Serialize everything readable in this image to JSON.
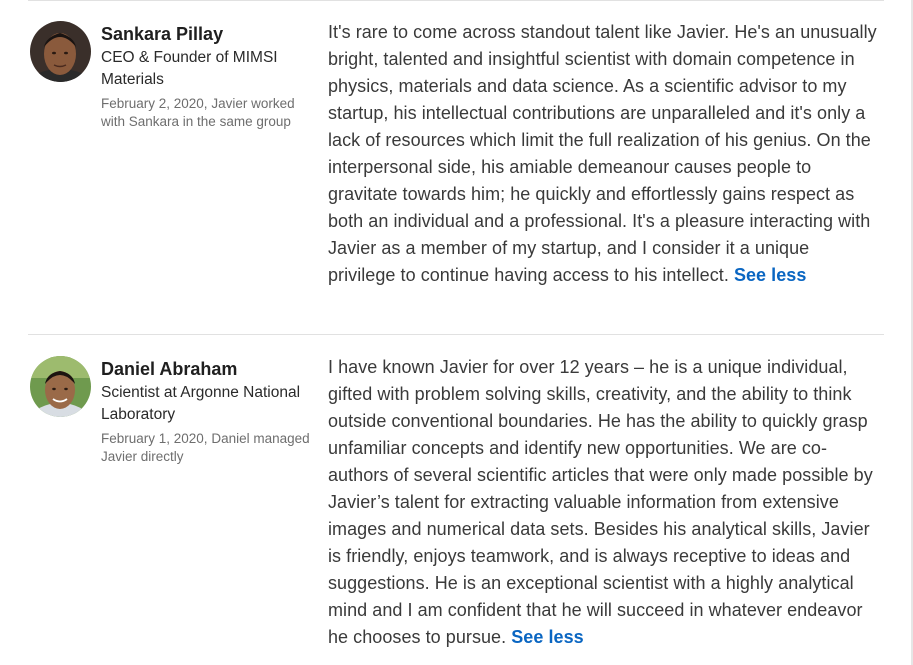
{
  "recommendations": [
    {
      "name": "Sankara Pillay",
      "headline": "CEO & Founder of MIMSI Materials",
      "meta": "February 2, 2020, Javier worked with Sankara in the same group",
      "text": "It's rare to come across standout talent like Javier. He's an unusually bright, talented and insightful scientist with domain competence in physics, materials and data science. As a scientific advisor to my startup, his intellectual contributions are unparalleled and it's only a lack of resources which limit the full realization of his genius. On the interpersonal side, his amiable demeanour causes people to gravitate towards him; he quickly and effortlessly gains respect as both an individual and a professional. It's a pleasure interacting with Javier as a member of my startup, and I consider it a unique privilege to continue having access to his intellect.",
      "toggle_label": "See less",
      "avatar_icon": "person-photo-avatar"
    },
    {
      "name": "Daniel Abraham",
      "headline": "Scientist at Argonne National Laboratory",
      "meta": "February 1, 2020, Daniel managed Javier directly",
      "text": "I have known Javier for over 12 years – he is a unique individual, gifted with problem solving skills, creativity, and the ability to think outside conventional boundaries. He has the ability to quickly grasp unfamiliar concepts and identify new opportunities. We are co-authors of several scientific articles that were only made possible by Javier’s talent for extracting valuable information from extensive images and numerical data sets. Besides his analytical skills, Javier is friendly, enjoys teamwork, and is always receptive to ideas and suggestions. He is an exceptional scientist with a highly analytical mind and I am confident that he will succeed in whatever endeavor he chooses to pursue.",
      "toggle_label": "See less",
      "avatar_icon": "person-photo-avatar"
    }
  ],
  "colors": {
    "link": "#0a66c2",
    "divider": "#e1e1e1",
    "meta_text": "#6e6e6e"
  }
}
